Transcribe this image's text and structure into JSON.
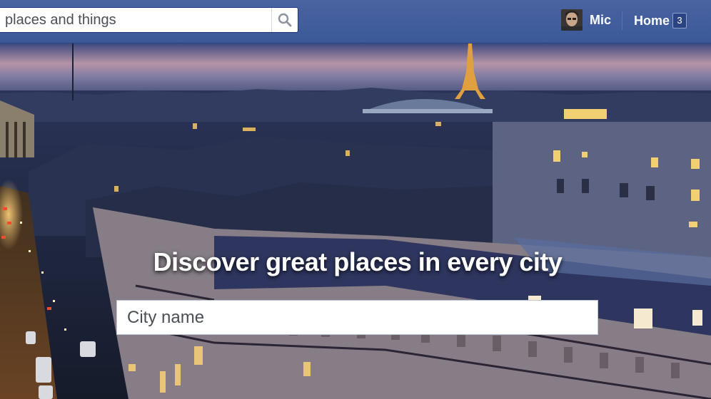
{
  "header": {
    "search": {
      "placeholder": "places and things"
    },
    "profile": {
      "name": "Mic"
    },
    "home": {
      "label": "Home",
      "badge": "3"
    }
  },
  "hero": {
    "headline": "Discover great places in every city",
    "city_input": {
      "placeholder": "City name"
    }
  },
  "colors": {
    "topbar": "#3b5998",
    "headline": "#ffffff"
  }
}
